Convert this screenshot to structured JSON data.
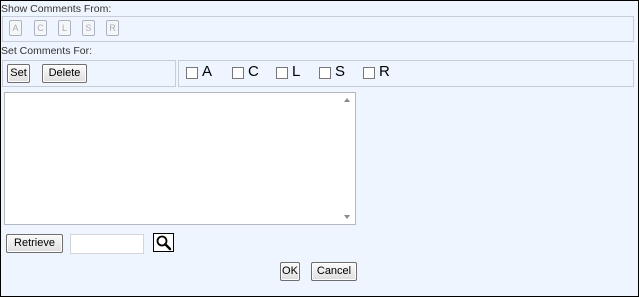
{
  "show_comments": {
    "label": "Show Comments From:",
    "filters": [
      "A",
      "C",
      "L",
      "S",
      "R"
    ]
  },
  "set_comments": {
    "label": "Set Comments For:",
    "set_label": "Set",
    "delete_label": "Delete",
    "checkboxes": [
      "A",
      "C",
      "L",
      "S",
      "R"
    ]
  },
  "comment_text": "",
  "retrieve": {
    "button_label": "Retrieve",
    "input_value": ""
  },
  "dialog": {
    "ok_label": "OK",
    "cancel_label": "Cancel"
  }
}
